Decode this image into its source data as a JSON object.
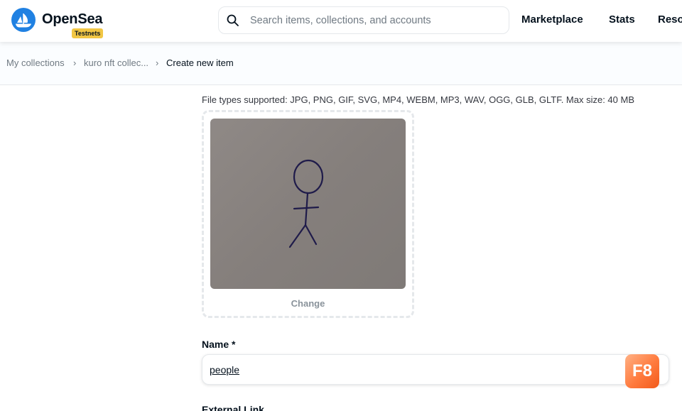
{
  "header": {
    "brand": "OpenSea",
    "badge": "Testnets",
    "search_placeholder": "Search items, collections, and accounts",
    "nav": [
      "Marketplace",
      "Stats",
      "Reso"
    ]
  },
  "breadcrumb": [
    "My collections",
    "kuro nft collec...",
    "Create new item"
  ],
  "breadcrumb_separator": "›",
  "form": {
    "file_types": "File types supported: JPG, PNG, GIF, SVG, MP4, WEBM, MP3, WAV, OGG, GLB, GLTF. Max size: 40 MB",
    "change_label": "Change",
    "name_label": "Name *",
    "name_value": "people",
    "next_label": "External Link"
  },
  "overlay_badge": "F8",
  "colors": {
    "brand_blue": "#2081e2",
    "badge_yellow": "#f1c644",
    "text_primary": "#04111d",
    "text_muted": "#707a83"
  },
  "icons": {
    "logo": "opensea-logo-icon",
    "search": "search-icon",
    "upload_preview": "stick-figure-image"
  }
}
